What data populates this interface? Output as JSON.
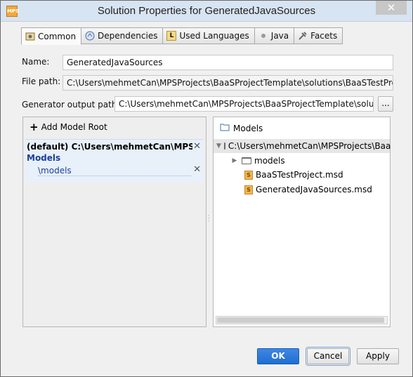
{
  "window": {
    "title": "Solution Properties for GeneratedJavaSources",
    "app_icon_text": "MPS",
    "close_glyph": "✕"
  },
  "tabs": [
    {
      "label": "Common",
      "icon": "common-icon",
      "active": true
    },
    {
      "label": "Dependencies",
      "icon": "dependencies-icon"
    },
    {
      "label": "Used Languages",
      "icon": "languages-icon",
      "icon_text": "L"
    },
    {
      "label": "Java",
      "icon": "java-icon"
    },
    {
      "label": "Facets",
      "icon": "facets-icon"
    }
  ],
  "form": {
    "name_label": "Name:",
    "name_value": "GeneratedJavaSources",
    "file_path_label": "File path:",
    "file_path_value": "C:\\Users\\mehmetCan\\MPSProjects\\BaaSProjectTemplate\\solutions\\BaaSTestProject\\G",
    "generator_label": "Generator output path:",
    "generator_value": "C:\\Users\\mehmetCan\\MPSProjects\\BaaSProjectTemplate\\solutions\\",
    "browse_label": "..."
  },
  "left_panel": {
    "add_model_root": "Add Model Root",
    "add_prefix": "+",
    "root_title": "(default) C:\\Users\\mehmetCan\\MPSProjects...",
    "models_label": "Models",
    "model_path": "\\models",
    "remove_glyph": "✕"
  },
  "right_panel": {
    "header": "Models",
    "tree": [
      {
        "label": "C:\\Users\\mehmetCan\\MPSProjects\\Baa",
        "type": "folder",
        "expanded": true
      },
      {
        "label": "models",
        "type": "folder",
        "expanded": false
      },
      {
        "label": "BaaSTestProject.msd",
        "type": "msd"
      },
      {
        "label": "GeneratedJavaSources.msd",
        "type": "msd"
      }
    ],
    "msd_icon_text": "S"
  },
  "buttons": {
    "ok": "OK",
    "cancel": "Cancel",
    "apply": "Apply"
  },
  "colors": {
    "primary": "#1e6fd2",
    "models_text": "#1b3f9b",
    "title_bar": "#d7e4f2"
  }
}
